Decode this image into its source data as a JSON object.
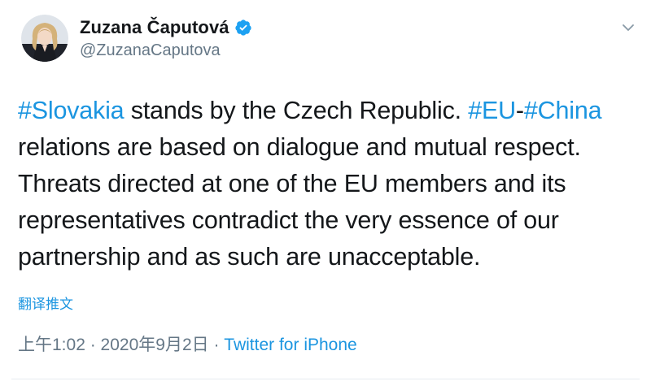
{
  "author": {
    "display_name": "Zuzana Čaputová",
    "handle": "@ZuzanaCaputova",
    "verified": true
  },
  "tweet": {
    "segments": [
      {
        "text": "#Slovakia",
        "type": "hashtag"
      },
      {
        "text": " stands by the Czech Republic. ",
        "type": "text"
      },
      {
        "text": "#EU",
        "type": "hashtag"
      },
      {
        "text": "-",
        "type": "text"
      },
      {
        "text": "#China",
        "type": "hashtag"
      },
      {
        "text": " relations are based on dialogue and mutual respect. Threats directed at one of the EU members and its representatives contradict the very essence of our partnership and as such are unacceptable.",
        "type": "text"
      }
    ]
  },
  "translate_label": "翻译推文",
  "meta": {
    "time": "上午1:02",
    "separator1": " · ",
    "date": "2020年9月2日",
    "separator2": " · ",
    "source": "Twitter for iPhone"
  },
  "colors": {
    "link": "#1b95e0",
    "secondary": "#657786",
    "text": "#14171a",
    "verified": "#1da1f2"
  },
  "icons": {
    "verified": "verified-badge-icon",
    "menu": "chevron-down-icon"
  }
}
